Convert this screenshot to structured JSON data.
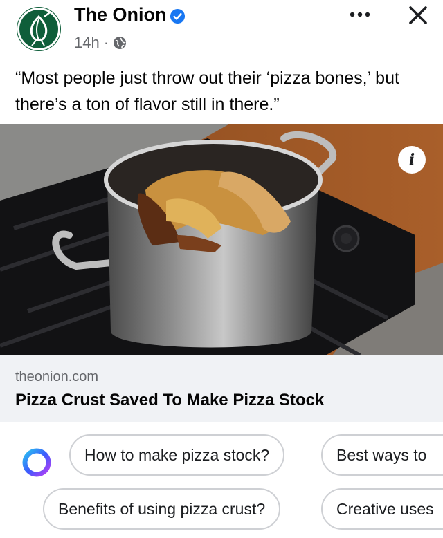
{
  "post": {
    "page_name": "The Onion",
    "time": "14h",
    "separator": "·",
    "caption": "“Most people just throw out their ‘pizza bones,’ but there’s a ton of flavor still in there.”"
  },
  "link": {
    "domain": "theonion.com",
    "title": "Pizza Crust Saved To Make Pizza Stock"
  },
  "suggestions": {
    "row1": [
      "How to make pizza stock?",
      "Best ways to"
    ],
    "row2": [
      "Benefits of using pizza crust?",
      "Creative uses"
    ]
  },
  "icons": {
    "more": "more-icon",
    "close": "close-icon",
    "verified": "verified-badge-icon",
    "audience": "globe-icon",
    "info": "info-icon",
    "ai": "meta-ai-icon"
  },
  "colors": {
    "verified": "#1877f2",
    "secondary_text": "#65676b",
    "link_card_bg": "#f0f2f5",
    "onion_green": "#0f5e3a"
  }
}
